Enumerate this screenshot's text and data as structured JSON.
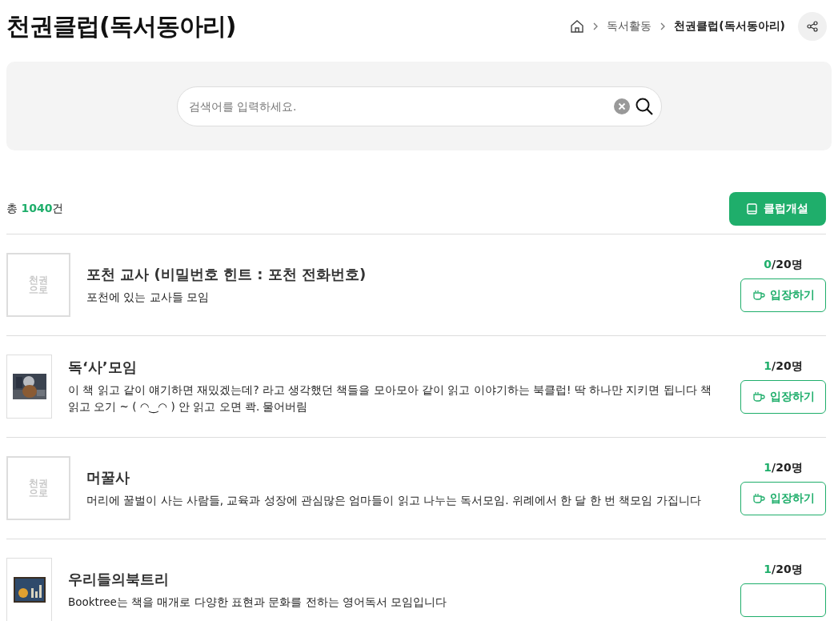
{
  "title": "천권클럽(독서동아리)",
  "breadcrumb": [
    "독서활동",
    "천권클럽(독서동아리)"
  ],
  "search": {
    "placeholder": "검색어를 입력하세요."
  },
  "total": {
    "prefix": "총 ",
    "count": "1040",
    "suffix": "건"
  },
  "create_button": "클럽개설",
  "clubs": [
    {
      "thumb": {
        "kind": "logo",
        "lines": [
          "천권",
          "으로"
        ]
      },
      "name": "포천 교사 (비밀번호 힌트 : 포천 전화번호)",
      "description": "포천에 있는 교사들 모임",
      "current": "0",
      "capacity": "/20명",
      "enter": "입장하기"
    },
    {
      "name": "독‘사’모임",
      "description": "이 책 읽고 같이 얘기하면 재밌겠는데? 라고 생각했던 책들을 모아모아 같이 읽고 이야기하는 북클럽! 딱 하나만 지키면 됩니다 책 읽고 오기 ~ ( ◠‿◠ ) 안 읽고 오면 콱. 물어버림",
      "current": "1",
      "capacity": "/20명",
      "enter": "입장하기"
    },
    {
      "thumb": {
        "kind": "logo",
        "lines": [
          "천권",
          "으로"
        ]
      },
      "name": "머꿀사",
      "description": "머리에 꿀벌이 사는 사람들, 교육과 성장에 관심많은 엄마들이 읽고 나누는 독서모임. 위례에서 한 달 한 번 책모임 가집니다",
      "current": "1",
      "capacity": "/20명",
      "enter": "입장하기"
    },
    {
      "name": "우리들의북트리",
      "description": "Booktree는 책을 매개로 다양한 표현과 문화를 전하는 영어독서 모임입니다",
      "current": "1",
      "capacity": "/20명"
    }
  ]
}
